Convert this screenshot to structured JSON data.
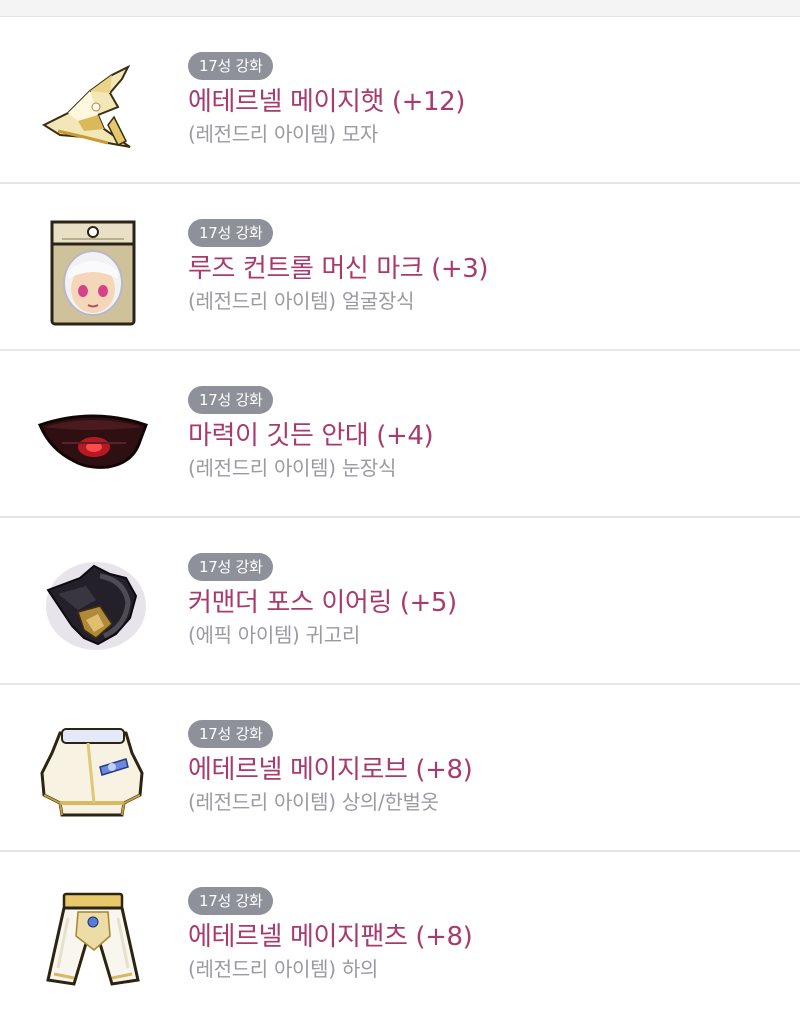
{
  "items": [
    {
      "badge": "17성 강화",
      "name": "에테르넬 메이지햇 (+12)",
      "sub": "(레전드리 아이템) 모자",
      "icon": "mage-hat-icon"
    },
    {
      "badge": "17성 강화",
      "name": "루즈 컨트롤 머신 마크 (+3)",
      "sub": "(레전드리 아이템) 얼굴장식",
      "icon": "machine-mark-icon"
    },
    {
      "badge": "17성 강화",
      "name": "마력이 깃든 안대 (+4)",
      "sub": "(레전드리 아이템) 눈장식",
      "icon": "eyepatch-icon"
    },
    {
      "badge": "17성 강화",
      "name": "커맨더 포스 이어링 (+5)",
      "sub": "(에픽 아이템) 귀고리",
      "icon": "earring-icon"
    },
    {
      "badge": "17성 강화",
      "name": "에테르넬 메이지로브 (+8)",
      "sub": "(레전드리 아이템) 상의/한벌옷",
      "icon": "mage-robe-icon"
    },
    {
      "badge": "17성 강화",
      "name": "에테르넬 메이지팬츠 (+8)",
      "sub": "(레전드리 아이템) 하의",
      "icon": "mage-pants-icon"
    }
  ],
  "colors": {
    "name": "#a83a6e",
    "badge_bg": "#8e909a",
    "sub": "#9a9aa2"
  }
}
